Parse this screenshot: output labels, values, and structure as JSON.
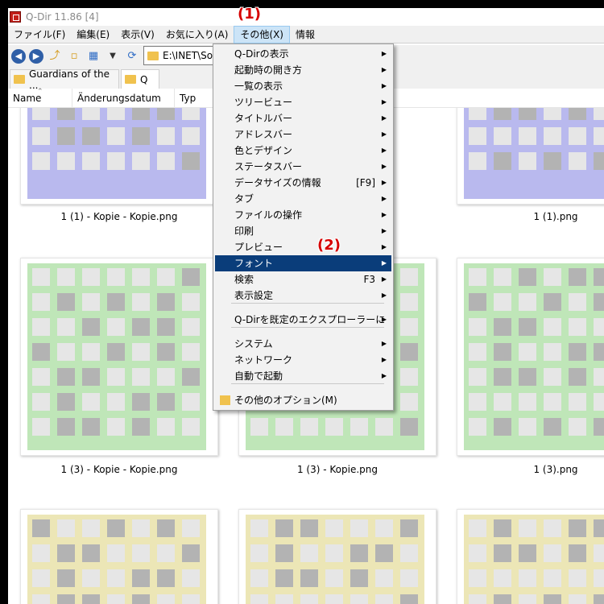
{
  "window": {
    "title": "Q-Dir 11.86 [4]"
  },
  "menubar": {
    "items": [
      "ファイル(F)",
      "編集(E)",
      "表示(V)",
      "お気に入り(A)",
      "その他(X)",
      "情報"
    ]
  },
  "toolbar": {
    "address": "E:\\INET\\Soft"
  },
  "tabs": [
    "Guardians of the ...",
    "Q"
  ],
  "columns": [
    "Name",
    "Änderungsdatum",
    "Typ"
  ],
  "files": [
    "1 (1) - Kopie - Kopie.png",
    "1 (1).png",
    "1 (3) - Kopie - Kopie.png",
    "1 (3) - Kopie.png",
    "1 (3).png"
  ],
  "annotations": [
    "(1)",
    "(2)"
  ],
  "menu": {
    "items": [
      {
        "label": "Q-Dirの表示",
        "shortcut": ""
      },
      {
        "label": "起動時の開き方",
        "shortcut": ""
      },
      {
        "label": "一覧の表示",
        "shortcut": ""
      },
      {
        "label": "ツリービュー",
        "shortcut": ""
      },
      {
        "label": "タイトルバー",
        "shortcut": ""
      },
      {
        "label": "アドレスバー",
        "shortcut": ""
      },
      {
        "label": "色とデザイン",
        "shortcut": ""
      },
      {
        "label": "ステータスバー",
        "shortcut": ""
      },
      {
        "label": "データサイズの情報",
        "shortcut": "[F9]"
      },
      {
        "label": "タブ",
        "shortcut": ""
      },
      {
        "label": "ファイルの操作",
        "shortcut": ""
      },
      {
        "label": "印刷",
        "shortcut": ""
      },
      {
        "label": "プレビュー",
        "shortcut": ""
      },
      {
        "label": "フォント",
        "shortcut": ""
      },
      {
        "label": "検索",
        "shortcut": "F3"
      },
      {
        "label": "表示設定",
        "shortcut": ""
      },
      {
        "label": "Q-Dirを既定のエクスプローラーに",
        "shortcut": ""
      },
      {
        "label": "システム",
        "shortcut": ""
      },
      {
        "label": "ネットワーク",
        "shortcut": ""
      },
      {
        "label": "自動で起動",
        "shortcut": ""
      },
      {
        "label": "その他のオプション(M)",
        "shortcut": ""
      }
    ]
  },
  "colors": {
    "accent": "#0a3d7a",
    "menu_active": "#cce4f7",
    "annotation": "#d60000"
  }
}
